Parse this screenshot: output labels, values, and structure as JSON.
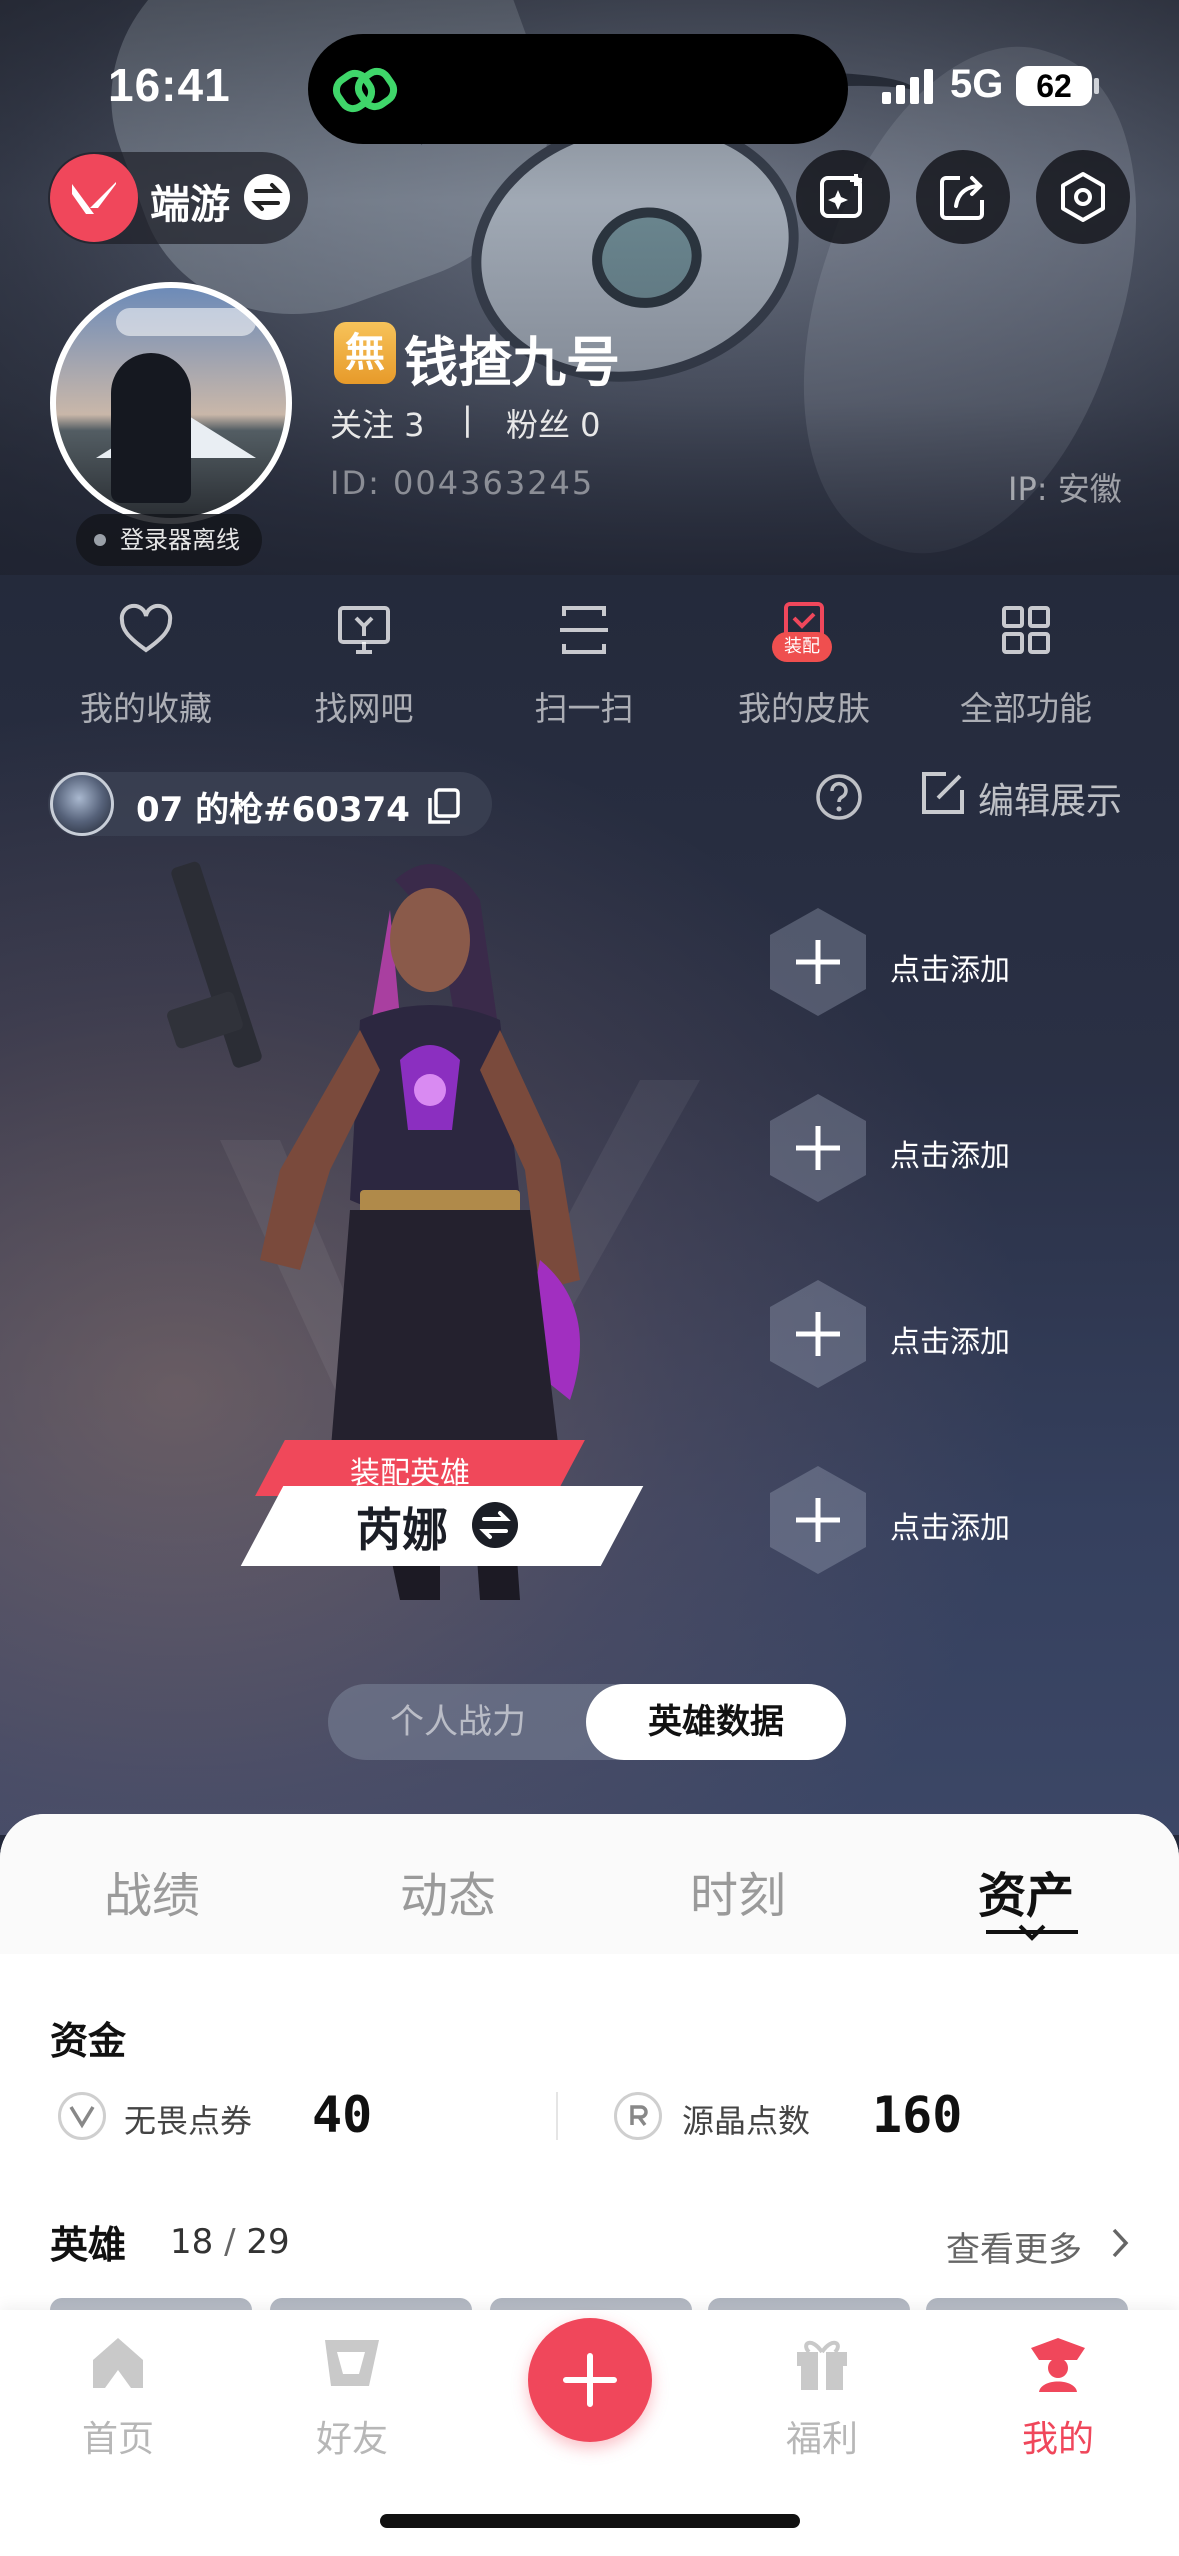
{
  "status_bar": {
    "time": "16:41",
    "network": "5G",
    "battery": "62"
  },
  "header": {
    "app_name": "端游"
  },
  "profile": {
    "badge": "無",
    "nickname": "钱揸九号",
    "following": "关注 3",
    "separator": "|",
    "fans": "粉丝 0",
    "id": "ID: 004363245",
    "ip": "IP: 安徽",
    "launcher_status": "登录器离线"
  },
  "quick_actions": [
    {
      "label": "我的收藏",
      "icon": "heart-icon"
    },
    {
      "label": "找网吧",
      "icon": "monitor-icon"
    },
    {
      "label": "扫一扫",
      "icon": "scan-icon"
    },
    {
      "label": "我的皮肤",
      "icon": "skin-icon",
      "tag": "装配"
    },
    {
      "label": "全部功能",
      "icon": "grid-icon"
    }
  ],
  "game_account": {
    "name": "07 的枪#60374",
    "edit_label": "编辑展示"
  },
  "agent": {
    "tag": "装配英雄",
    "name": "芮娜"
  },
  "slots": [
    {
      "label": "点击添加"
    },
    {
      "label": "点击添加"
    },
    {
      "label": "点击添加"
    },
    {
      "label": "点击添加"
    }
  ],
  "segment": {
    "options": [
      "个人战力",
      "英雄数据"
    ],
    "selected": "英雄数据"
  },
  "sheet": {
    "tabs": [
      "战绩",
      "动态",
      "时刻",
      "资产"
    ],
    "active_tab": "资产",
    "funds": {
      "title": "资金",
      "items": [
        {
          "label": "无畏点券",
          "value": "40",
          "icon": "vp-icon"
        },
        {
          "label": "源晶点数",
          "value": "160",
          "icon": "radianite-icon"
        }
      ]
    },
    "heroes": {
      "title": "英雄",
      "owned": "18",
      "slash": " / ",
      "total": "29",
      "more": "查看更多"
    }
  },
  "tabbar": {
    "items": [
      {
        "label": "首页",
        "icon": "home-icon"
      },
      {
        "label": "好友",
        "icon": "friends-icon"
      },
      {
        "label": "福利",
        "icon": "gift-icon"
      },
      {
        "label": "我的",
        "icon": "me-icon"
      }
    ],
    "active": "我的"
  },
  "colors": {
    "accent": "#f0475b",
    "gold_badge": "#f2b24a",
    "sheet_bg": "#ffffff"
  }
}
